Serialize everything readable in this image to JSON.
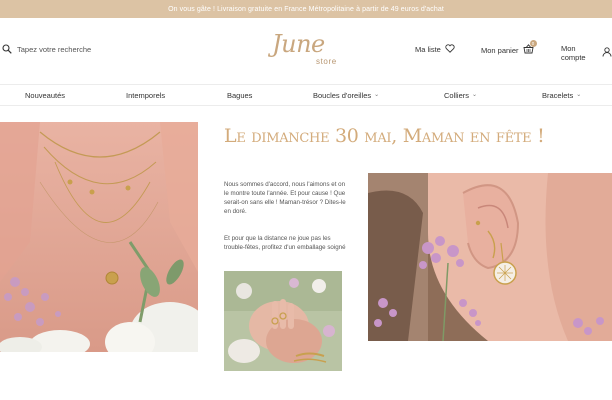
{
  "promo": {
    "text": "On vous gâte ! Livraison gratuite en France Métropolitaine à partir de 49 euros d'achat"
  },
  "header": {
    "search_placeholder": "Tapez votre recherche",
    "logo_script": "June",
    "logo_store": "store",
    "wishlist_label": "Ma liste",
    "cart_label": "Mon panier",
    "cart_count": "0",
    "account_label": "Mon compte"
  },
  "nav": {
    "items": [
      {
        "label": "Nouveautés"
      },
      {
        "label": "Intemporels"
      },
      {
        "label": "Bagues"
      },
      {
        "label": "Boucles d'oreilles"
      },
      {
        "label": "Colliers"
      },
      {
        "label": "Bracelets"
      }
    ]
  },
  "main": {
    "headline": "Le dimanche 30 mai, Maman en fête !",
    "paragraph1": "Nous sommes d'accord, nous l'aimons et on le montre toute l'année. Et pour cause ! Que serait-on sans elle ! Maman-trésor ? Dites-le en doré.",
    "paragraph2": "Et pour que la distance ne joue pas les trouble-fêtes, profitez d'un emballage soigné"
  },
  "colors": {
    "promo_bg": "#dcc3a4",
    "accent": "#d3ab7b"
  },
  "icons": [
    "search-icon",
    "heart-icon",
    "basket-icon",
    "user-icon",
    "chevron-down-icon"
  ]
}
